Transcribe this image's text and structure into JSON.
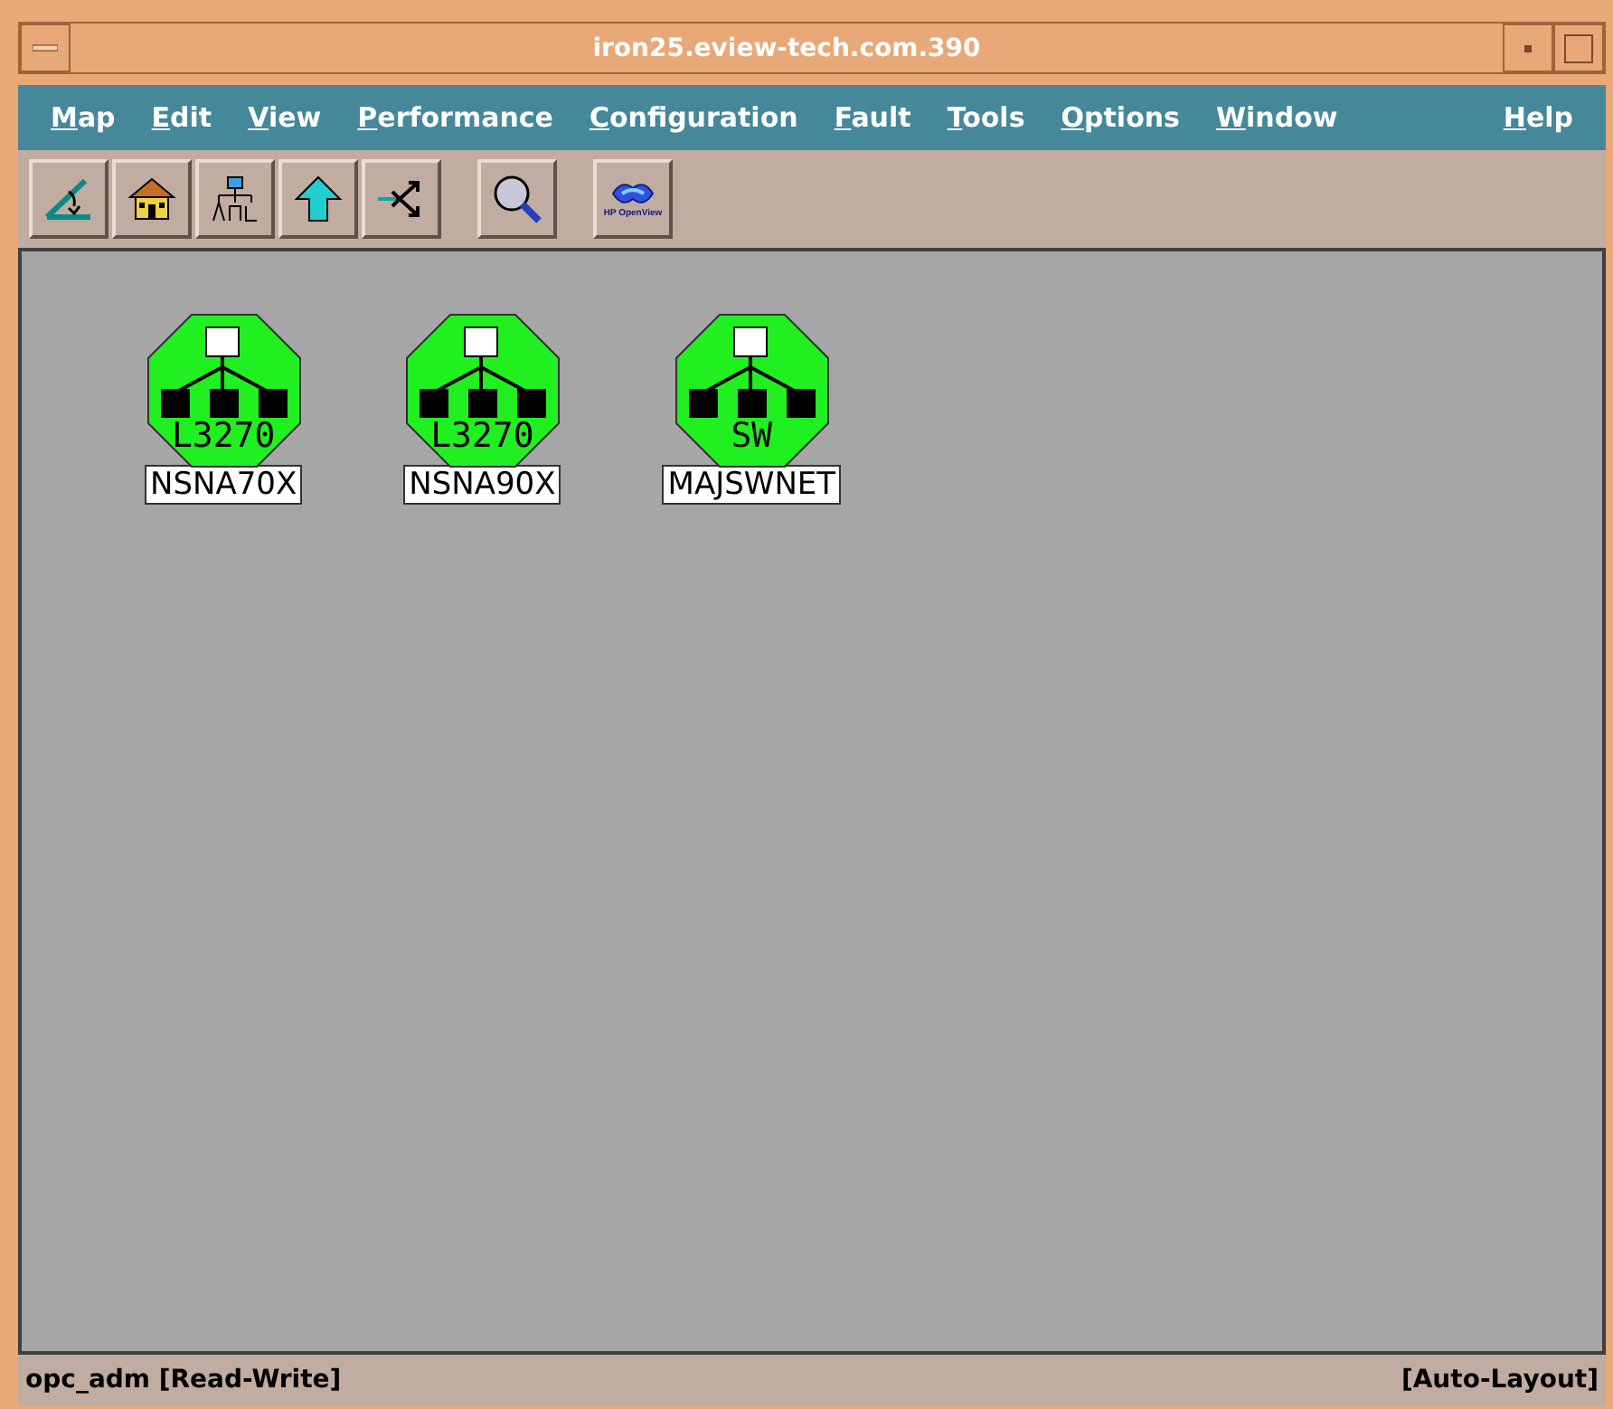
{
  "window": {
    "title": "iron25.eview-tech.com.390"
  },
  "menu": [
    {
      "label": "Map"
    },
    {
      "label": "Edit"
    },
    {
      "label": "View"
    },
    {
      "label": "Performance"
    },
    {
      "label": "Configuration"
    },
    {
      "label": "Fault"
    },
    {
      "label": "Tools"
    },
    {
      "label": "Options"
    },
    {
      "label": "Window"
    },
    {
      "label": "Help"
    }
  ],
  "toolbar": [
    {
      "kind": "close-map"
    },
    {
      "kind": "home"
    },
    {
      "kind": "root"
    },
    {
      "kind": "parent"
    },
    {
      "kind": "quick-navigator"
    },
    {
      "kind": "search"
    },
    {
      "kind": "logo",
      "text": "HP OpenView"
    }
  ],
  "nodes": [
    {
      "symbol_text": "L3270",
      "label": "NSNA70X"
    },
    {
      "symbol_text": "L3270",
      "label": "NSNA90X"
    },
    {
      "symbol_text": "SW",
      "label": "MAJSWNET"
    }
  ],
  "status_bar": {
    "left": "opc_adm [Read-Write]",
    "right": "[Auto-Layout]"
  }
}
